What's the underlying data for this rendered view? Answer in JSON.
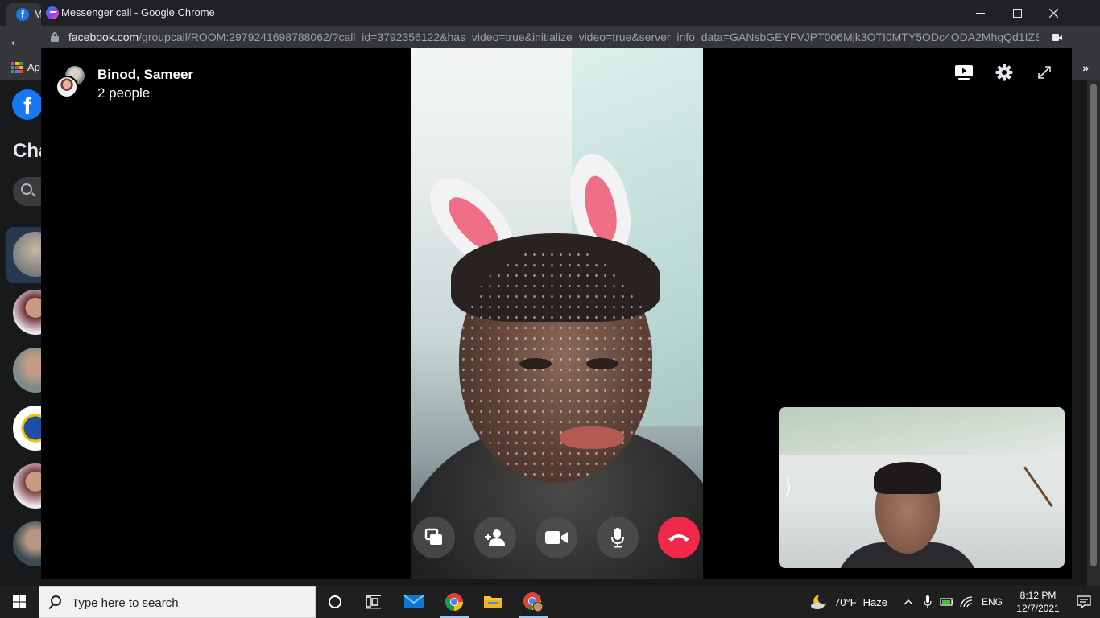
{
  "background_browser": {
    "tab_letter": "M",
    "bookmarks_label": "Ap",
    "facebook_logo_letter": "f",
    "chats_title": "Cha",
    "search_letter": "S"
  },
  "popup": {
    "window_title": "Messenger call - Google Chrome",
    "url_host": "facebook.com",
    "url_path": "/groupcall/ROOM:2979241698788062/?call_id=3792356122&has_video=true&initialize_video=true&server_info_data=GANsbGEYFVJPT006Mjk3OTI0MTY5ODc4ODA2MhgQd1IZSH..."
  },
  "call": {
    "participants": "Binod, Sameer",
    "people_count": "2 people"
  },
  "taskbar": {
    "search_placeholder": "Type here to search",
    "temperature": "70°F",
    "weather": "Haze",
    "language": "ENG",
    "time": "8:12 PM",
    "date": "12/7/2021"
  },
  "colors": {
    "end_call": "#f02849",
    "fb_blue": "#1877f2",
    "titlebar": "#202124",
    "addressbar": "#35363a"
  }
}
